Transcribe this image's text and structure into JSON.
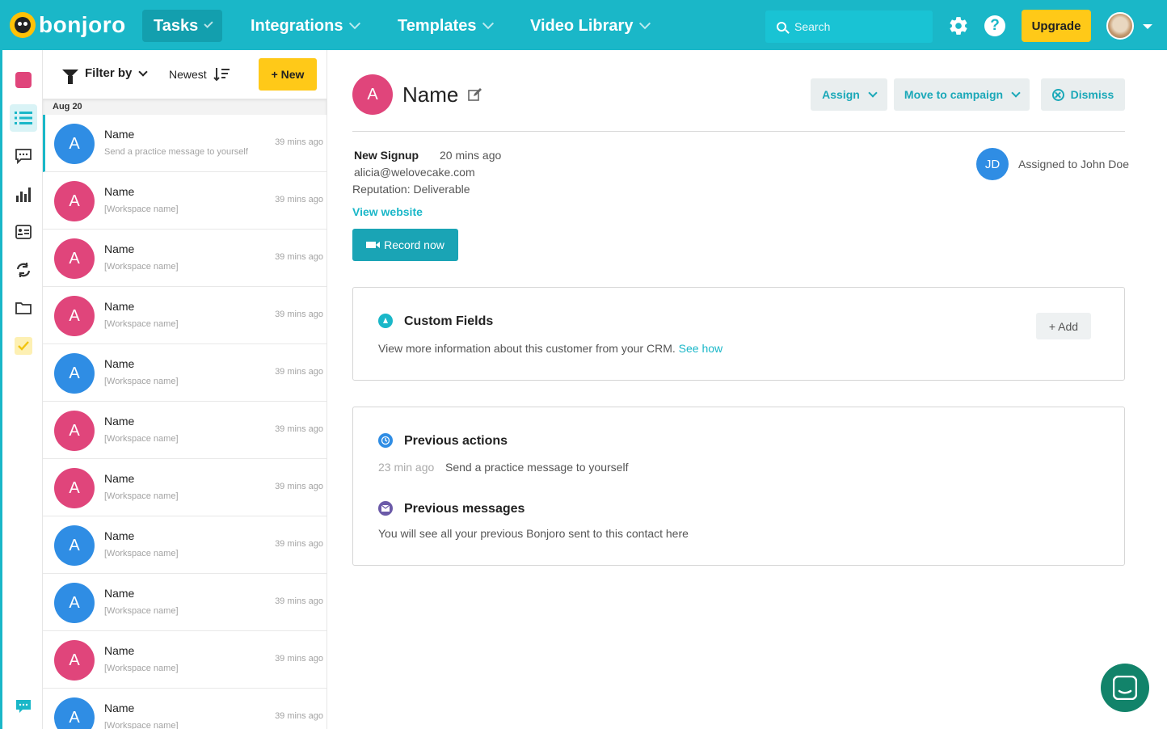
{
  "brand": {
    "name": "bonjoro",
    "accent": "#1ab7c8",
    "yellow": "#ffc918"
  },
  "nav": {
    "tasks": "Tasks",
    "integrations": "Integrations",
    "templates": "Templates",
    "video_library": "Video Library",
    "search_placeholder": "Search",
    "upgrade": "Upgrade"
  },
  "rail": {
    "items": [
      "record-icon",
      "list-icon",
      "chat-icon",
      "chart-icon",
      "contact-card-icon",
      "sync-icon",
      "folder-icon",
      "checkbox-icon",
      "message-icon"
    ]
  },
  "list": {
    "filter_label": "Filter by",
    "sort_label": "Newest",
    "new_label": "+ New",
    "date_header": "Aug 20",
    "rows": [
      {
        "initial": "A",
        "name": "Name",
        "sub": "Send a practice message to yourself",
        "time": "39 mins ago",
        "color": "blue"
      },
      {
        "initial": "A",
        "name": "Name",
        "sub": "[Workspace name]",
        "time": "39 mins ago",
        "color": "pink"
      },
      {
        "initial": "A",
        "name": "Name",
        "sub": "[Workspace name]",
        "time": "39 mins ago",
        "color": "pink"
      },
      {
        "initial": "A",
        "name": "Name",
        "sub": "[Workspace name]",
        "time": "39 mins ago",
        "color": "pink"
      },
      {
        "initial": "A",
        "name": "Name",
        "sub": "[Workspace name]",
        "time": "39 mins ago",
        "color": "blue"
      },
      {
        "initial": "A",
        "name": "Name",
        "sub": "[Workspace name]",
        "time": "39 mins ago",
        "color": "pink"
      },
      {
        "initial": "A",
        "name": "Name",
        "sub": "[Workspace name]",
        "time": "39 mins ago",
        "color": "pink"
      },
      {
        "initial": "A",
        "name": "Name",
        "sub": "[Workspace name]",
        "time": "39 mins ago",
        "color": "blue"
      },
      {
        "initial": "A",
        "name": "Name",
        "sub": "[Workspace name]",
        "time": "39 mins ago",
        "color": "blue"
      },
      {
        "initial": "A",
        "name": "Name",
        "sub": "[Workspace name]",
        "time": "39 mins ago",
        "color": "pink"
      },
      {
        "initial": "A",
        "name": "Name",
        "sub": "[Workspace name]",
        "time": "39 mins ago",
        "color": "blue"
      }
    ]
  },
  "detail": {
    "initial": "A",
    "name": "Name",
    "assign": "Assign",
    "move": "Move to campaign",
    "dismiss": "Dismiss",
    "event": "New Signup",
    "event_time": "20 mins ago",
    "email": "alicia@welovecake.com",
    "reputation": "Reputation: Deliverable",
    "view_website": "View website",
    "record": "Record now",
    "assignee_initials": "JD",
    "assigned_text": "Assigned to John Doe",
    "custom_fields": {
      "title": "Custom Fields",
      "text": "View more information about this customer from your CRM.",
      "link": "See how",
      "add": "+ Add"
    },
    "previous_actions": {
      "title": "Previous actions",
      "time": "23 min ago",
      "text": "Send a practice message to yourself"
    },
    "previous_messages": {
      "title": "Previous messages",
      "text": "You will see all your previous Bonjoro sent to this contact here"
    }
  }
}
